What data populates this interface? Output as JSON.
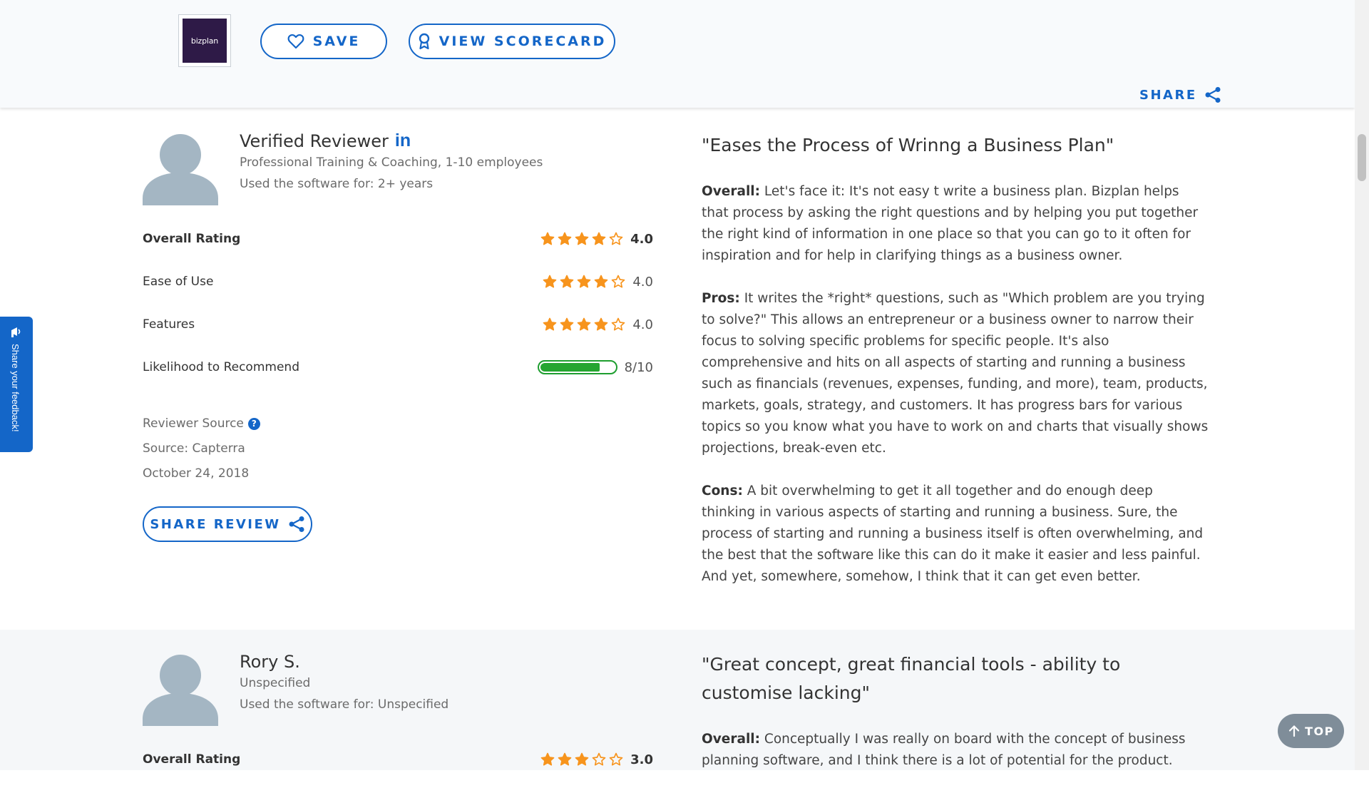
{
  "header": {
    "logo_text": "bizplan",
    "save_label": "SAVE",
    "scorecard_label": "VIEW SCORECARD",
    "share_label": "SHARE"
  },
  "reviews": [
    {
      "name": "Verified Reviewer",
      "linkedin": "in",
      "company": "Professional Training & Coaching, 1-10 employees",
      "usage": "Used the software for: 2+ years",
      "ratings": [
        {
          "label": "Overall Rating",
          "stars": 4,
          "value": "4.0"
        },
        {
          "label": "Ease of Use",
          "stars": 4,
          "value": "4.0"
        },
        {
          "label": "Features",
          "stars": 4,
          "value": "4.0"
        }
      ],
      "recommend": {
        "label": "Likelihood to Recommend",
        "score": 8,
        "value": "8/10"
      },
      "source_label": "Reviewer Source",
      "help": "?",
      "source": "Source: Capterra",
      "date": "October 24, 2018",
      "share_review_label": "SHARE REVIEW",
      "title": "\"Eases the Process of Wrinng a Business Plan\"",
      "overall_label": "Overall:",
      "overall": "Let's face it: It's not easy t write a business plan. Bizplan helps that process by asking the right questions and by helping you put together the right kind of information in one place so that you can go to it often for inspiration and for help in clarifying things as a business owner.",
      "pros_label": "Pros:",
      "pros": "It writes the *right* questions, such as \"Which problem are you trying to solve?\" This allows an entrepreneur or a business owner to narrow their focus to solving specific problems for specific people. It's also comprehensive and hits on all aspects of starting and running a business such as financials (revenues, expenses, funding, and more), team, products, markets, goals, strategy, and customers. It has progress bars for various topics so you know what you have to work on and charts that visually shows projections, break-even etc.",
      "cons_label": "Cons:",
      "cons": "A bit overwhelming to get it all together and do enough deep thinking in various aspects of starting and running a business. Sure, the process of starting and running a business itself is often overwhelming, and the best that the software like this can do it make it easier and less painful. And yet, somewhere, somehow, I think that it can get even better."
    },
    {
      "name": "Rory S.",
      "company": "Unspecified",
      "usage": "Used the software for: Unspecified",
      "ratings": [
        {
          "label": "Overall Rating",
          "stars": 3,
          "value": "3.0"
        }
      ],
      "title": "\"Great concept, great financial tools - ability to customise lacking\"",
      "overall_label": "Overall:",
      "overall": "Conceptually I was really on board with the concept of business planning software, and I think there is a lot of potential for the product."
    }
  ],
  "feedback_tab": "Share your feedback!",
  "top_button": "TOP",
  "colors": {
    "accent": "#1466c8",
    "star": "#f7941d",
    "bar": "#26a531",
    "avatar": "#a4b6c3"
  },
  "icons": [
    "heart-icon",
    "award-icon",
    "share-icon",
    "linkedin-icon",
    "star-icon",
    "help-icon",
    "megaphone-icon",
    "arrow-up-icon"
  ]
}
